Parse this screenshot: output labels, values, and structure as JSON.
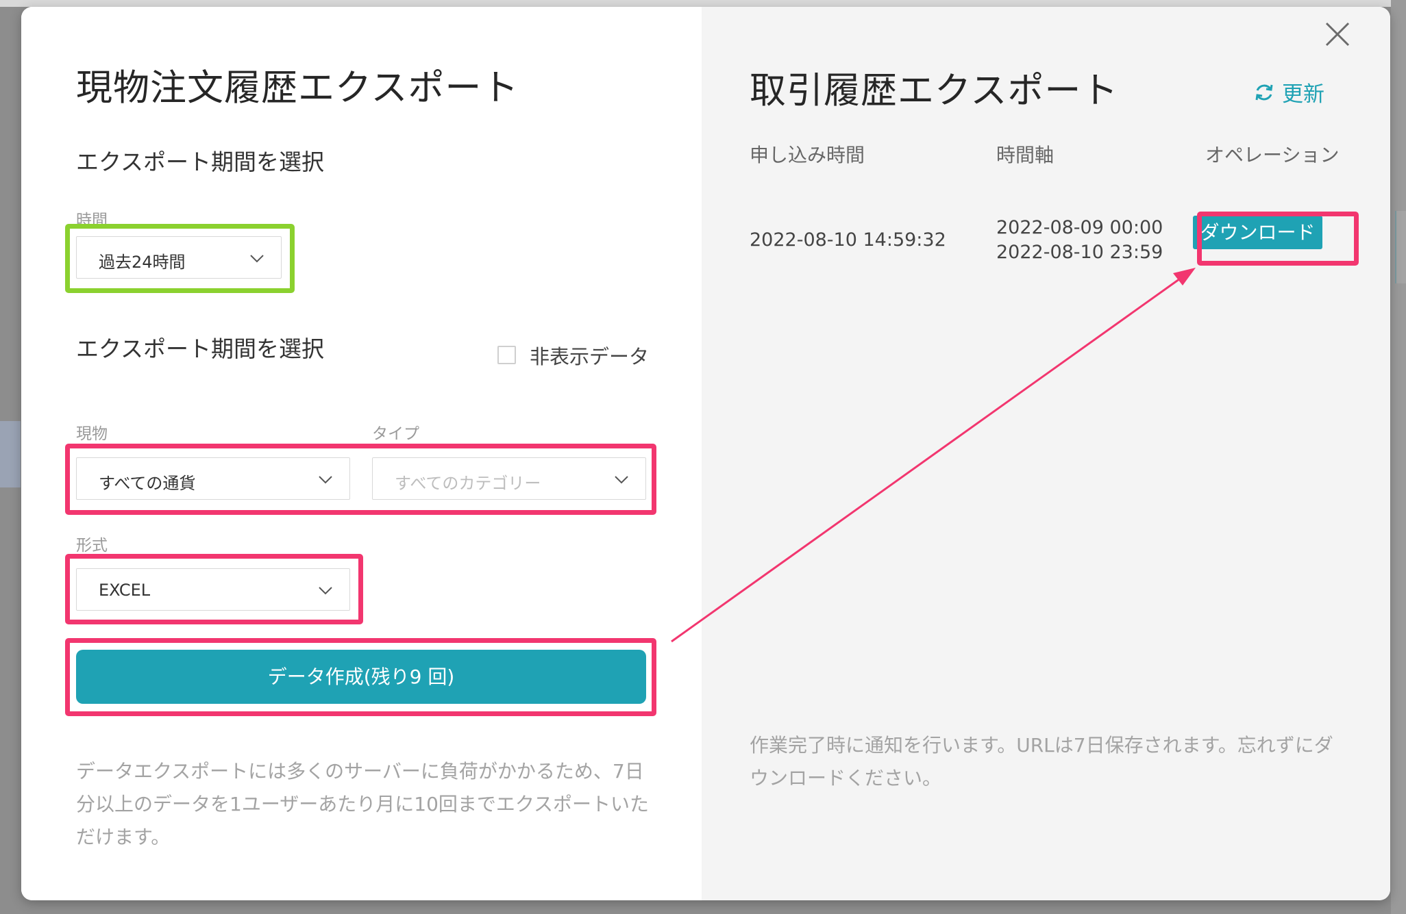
{
  "colors": {
    "accent": "#1fa2b4",
    "highlight_green": "#8bd12f",
    "highlight_pink": "#f2366f",
    "annotation_arrow": "#f2366f"
  },
  "left": {
    "title": "現物注文履歴エクスポート",
    "period_section": "エクスポート期間を選択",
    "time_label": "時間",
    "time_value": "過去24時間",
    "section2": "エクスポート期間を選択",
    "hidden_data_label": "非表示データ",
    "spot_label": "現物",
    "spot_value": "すべての通貨",
    "type_label": "タイプ",
    "type_placeholder": "すべてのカテゴリー",
    "format_label": "形式",
    "format_value": "EXCEL",
    "create_button": "データ作成(残り9 回)",
    "note_lines": [
      "データエクスポートには多くのサーバーに負荷がかかるため、7日",
      "分以上のデータを1ユーザーあたり月に10回までエクスポートいた",
      "だけます。"
    ]
  },
  "right": {
    "title": "取引履歴エクスポート",
    "refresh_label": "更新",
    "headers": {
      "applied": "申し込み時間",
      "range": "時間軸",
      "operation": "オペレーション"
    },
    "row": {
      "applied": "2022-08-10 14:59:32",
      "range_start": "2022-08-09 00:00",
      "range_end": "2022-08-10 23:59",
      "download": "ダウンロード"
    },
    "note_lines": [
      "作業完了時に通知を行います。URLは7日保存されます。忘れずにダ",
      "ウンロードください。"
    ]
  },
  "icons": {
    "close": "close-icon",
    "refresh": "refresh-icon",
    "chevron": "chevron-down-icon"
  }
}
